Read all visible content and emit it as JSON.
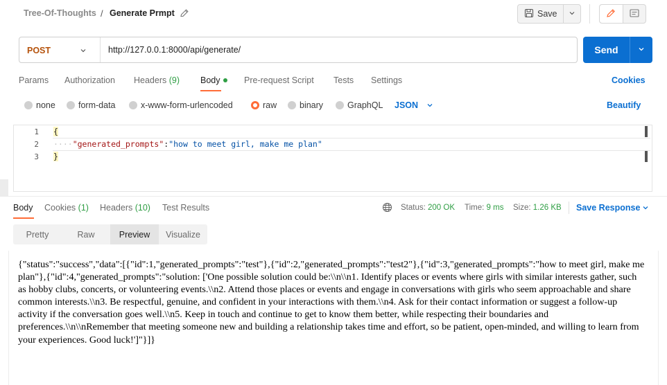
{
  "header": {
    "breadcrumb_parent": "Tree-Of-Thoughts",
    "breadcrumb_separator": "/",
    "request_name": "Generate Prmpt",
    "save_label": "Save",
    "icons": [
      "pencil-icon",
      "save-icon",
      "chevron-down-icon",
      "edit-icon",
      "comment-icon"
    ]
  },
  "request": {
    "method": "POST",
    "url": "http://127.0.0.1:8000/api/generate/",
    "send_label": "Send"
  },
  "request_tabs": {
    "params": "Params",
    "authorization": "Authorization",
    "headers": "Headers",
    "headers_count": "(9)",
    "body": "Body",
    "prerequest": "Pre-request Script",
    "tests": "Tests",
    "settings": "Settings",
    "cookies": "Cookies",
    "active": "Body"
  },
  "body_types": {
    "none": "none",
    "form_data": "form-data",
    "urlencoded": "x-www-form-urlencoded",
    "raw": "raw",
    "binary": "binary",
    "graphql": "GraphQL",
    "selected": "raw",
    "format": "JSON",
    "beautify": "Beautify"
  },
  "editor": {
    "line_numbers": [
      "1",
      "2",
      "3"
    ],
    "open_brace": "{",
    "indent_dots": "····",
    "key": "\"generated_prompts\"",
    "colon": ":",
    "value": "\"how to meet girl, make me plan\"",
    "close_brace": "}"
  },
  "response_tabs": {
    "body": "Body",
    "cookies": "Cookies",
    "cookies_count": "(1)",
    "headers": "Headers",
    "headers_count": "(10)",
    "test_results": "Test Results",
    "active": "Body"
  },
  "response_meta": {
    "status_label": "Status:",
    "status_value": "200 OK",
    "time_label": "Time:",
    "time_value": "9 ms",
    "size_label": "Size:",
    "size_value": "1.26 KB",
    "save_response": "Save Response"
  },
  "view_modes": {
    "pretty": "Pretty",
    "raw": "Raw",
    "preview": "Preview",
    "visualize": "Visualize",
    "active": "Preview"
  },
  "preview": {
    "text": "{\"status\":\"success\",\"data\":[{\"id\":1,\"generated_prompts\":\"test\"},{\"id\":2,\"generated_prompts\":\"test2\"},{\"id\":3,\"generated_prompts\":\"how to meet girl, make me plan\"},{\"id\":4,\"generated_prompts\":\"solution: ['One possible solution could be:\\\\n\\\\n1. Identify places or events where girls with similar interests gather, such as hobby clubs, concerts, or volunteering events.\\\\n2. Attend those places or events and engage in conversations with girls who seem approachable and share common interests.\\\\n3. Be respectful, genuine, and confident in your interactions with them.\\\\n4. Ask for their contact information or suggest a follow-up activity if the conversation goes well.\\\\n5. Keep in touch and continue to get to know them better, while respecting their boundaries and preferences.\\\\n\\\\nRemember that meeting someone new and building a relationship takes time and effort, so be patient, open-minded, and willing to learn from your experiences. Good luck!']\"}]}"
  },
  "colors": {
    "accent": "#ff6c37",
    "primary": "#0b6fd1",
    "success": "#2f9e44",
    "method": "#b5520b"
  }
}
